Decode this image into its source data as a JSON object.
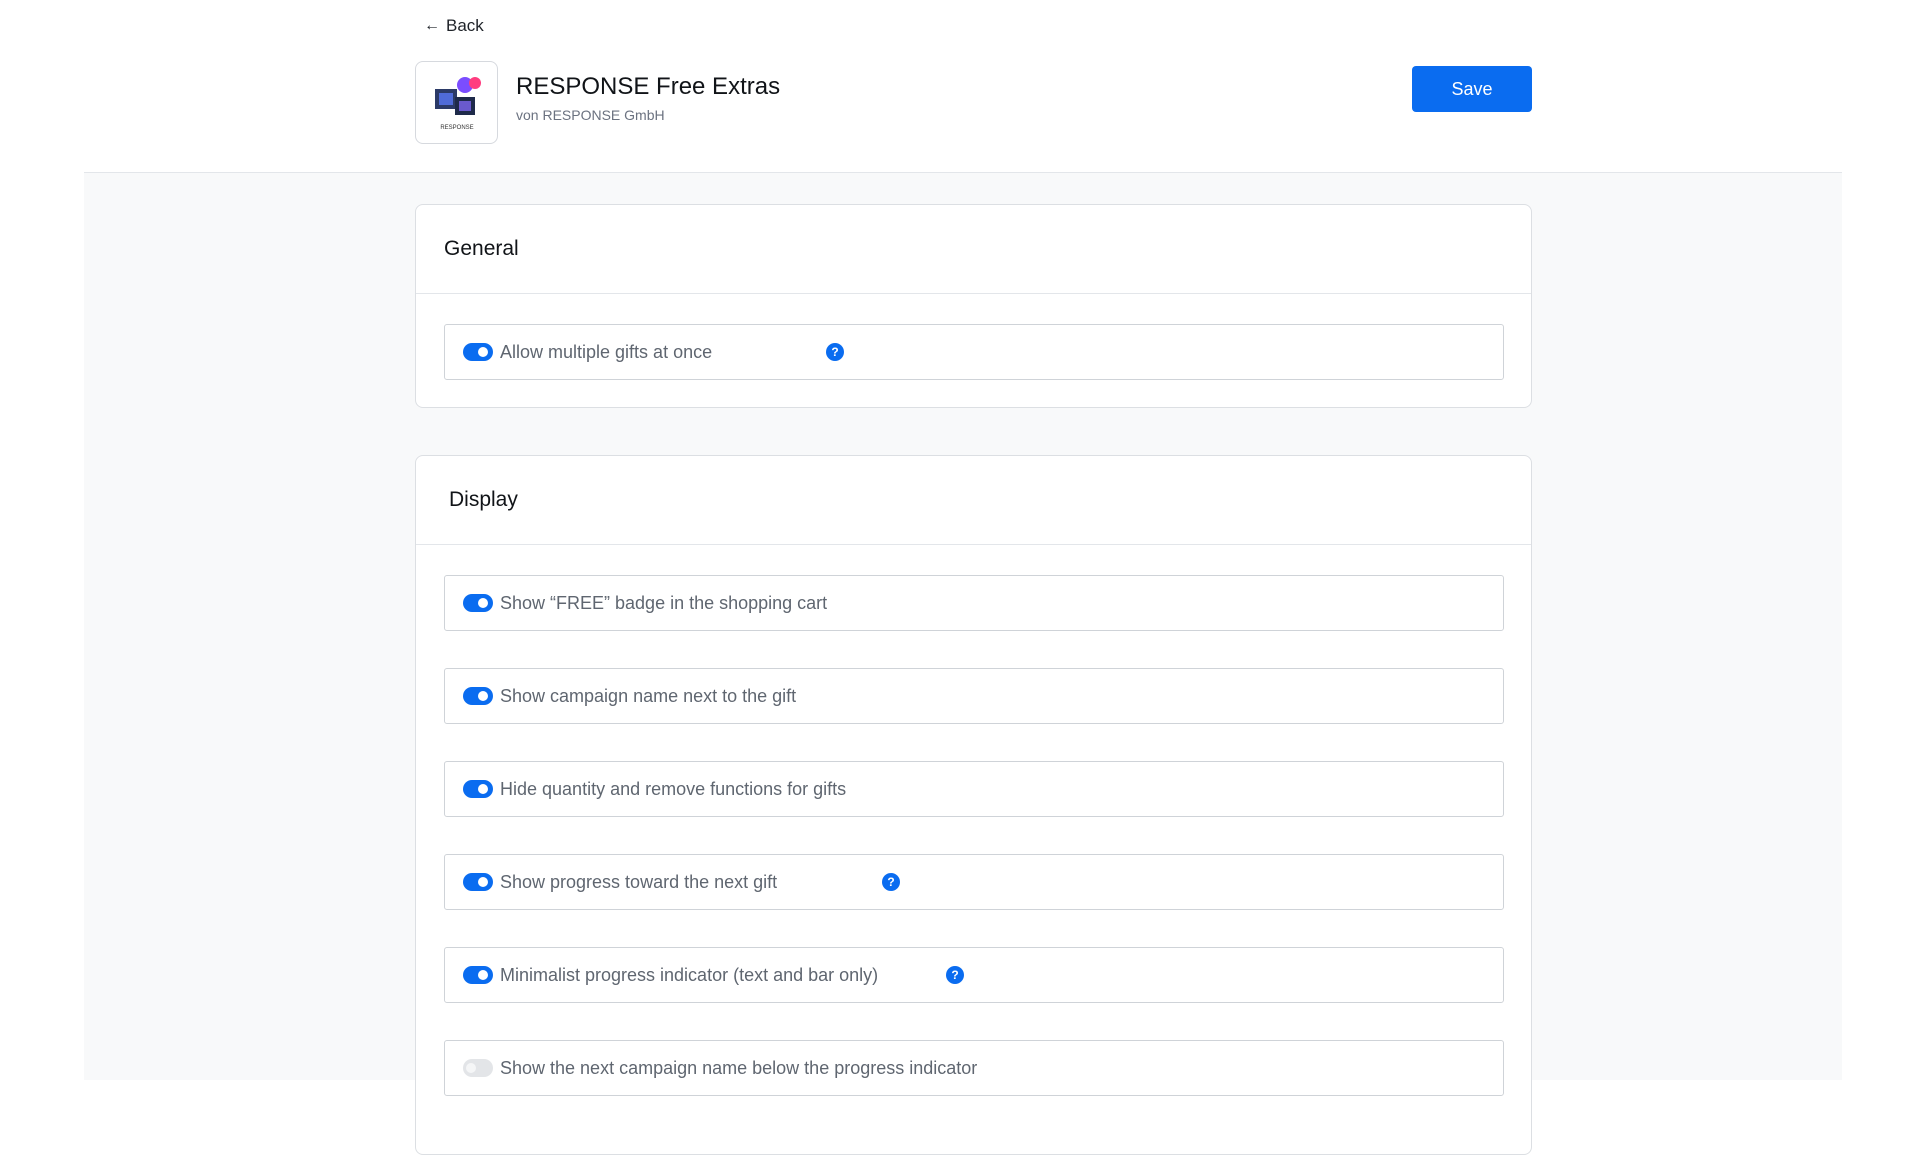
{
  "header": {
    "back_label": "Back",
    "app_title": "RESPONSE Free Extras",
    "app_vendor": "von RESPONSE GmbH",
    "save_label": "Save",
    "logo_text": "RESPONSE"
  },
  "colors": {
    "accent": "#0a6cf0",
    "toggle_off": "#e3e5e8",
    "page_bg": "#f8f9fa"
  },
  "general": {
    "title": "General",
    "settings": [
      {
        "label": "Allow multiple gifts at once",
        "enabled": true,
        "has_help": true
      }
    ]
  },
  "display": {
    "title": "Display",
    "settings": [
      {
        "label": "Show “FREE” badge in the shopping cart",
        "enabled": true,
        "has_help": false
      },
      {
        "label": "Show campaign name next to the gift",
        "enabled": true,
        "has_help": false
      },
      {
        "label": "Hide quantity and remove functions for gifts",
        "enabled": true,
        "has_help": false
      },
      {
        "label": "Show progress toward the next gift",
        "enabled": true,
        "has_help": true
      },
      {
        "label": "Minimalist progress indicator (text and bar only)",
        "enabled": true,
        "has_help": true
      },
      {
        "label": "Show the next campaign name below the progress indicator",
        "enabled": false,
        "has_help": false
      }
    ]
  },
  "help_icon_glyph": "?"
}
